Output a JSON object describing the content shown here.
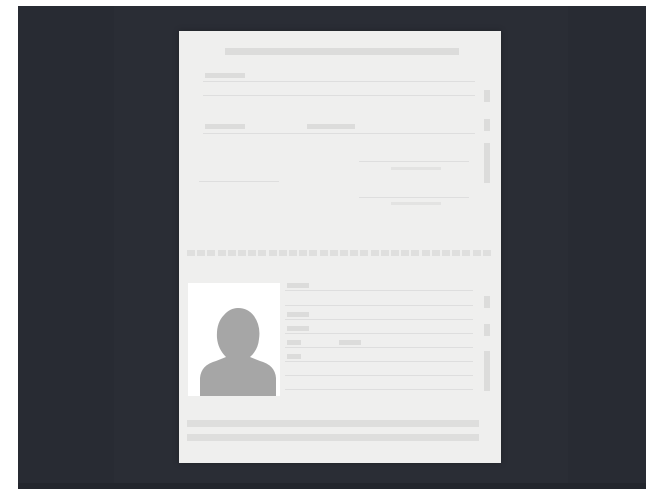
{
  "screen": {
    "background_color": "#2a2d35",
    "document_color": "#efefee"
  },
  "document": {
    "type_icon": "passport-page",
    "photo": {
      "icon": "person-silhouette-icon",
      "color": "#a6a6a6"
    }
  }
}
